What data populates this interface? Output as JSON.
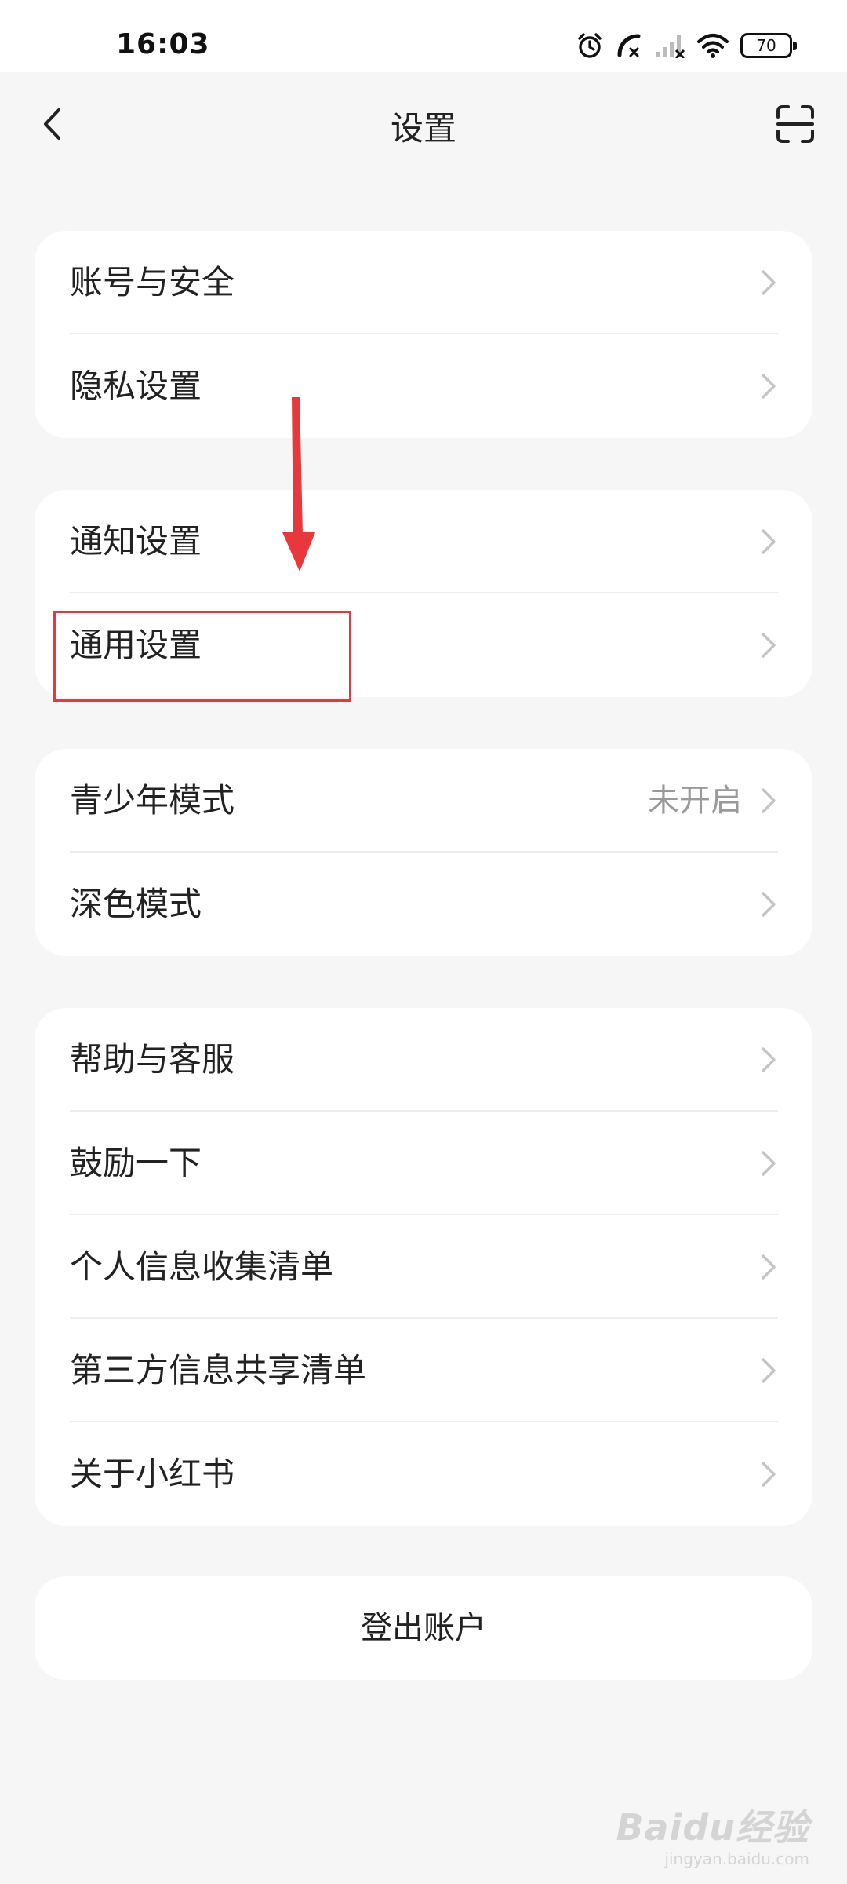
{
  "status_bar": {
    "time": "16:03",
    "battery": "70",
    "icons": [
      "alarm-icon",
      "missed-call-icon",
      "signal-icon",
      "wifi-icon",
      "battery-icon"
    ]
  },
  "header": {
    "title": "设置",
    "back_icon": "back-arrow-icon",
    "scan_icon": "scan-icon"
  },
  "groups": [
    {
      "items": [
        {
          "label": "账号与安全"
        },
        {
          "label": "隐私设置"
        }
      ]
    },
    {
      "items": [
        {
          "label": "通知设置"
        },
        {
          "label": "通用设置"
        }
      ]
    },
    {
      "items": [
        {
          "label": "青少年模式",
          "value": "未开启"
        },
        {
          "label": "深色模式"
        }
      ]
    },
    {
      "items": [
        {
          "label": "帮助与客服"
        },
        {
          "label": "鼓励一下"
        },
        {
          "label": "个人信息收集清单"
        },
        {
          "label": "第三方信息共享清单"
        },
        {
          "label": "关于小红书"
        }
      ]
    }
  ],
  "logout_label": "登出账户",
  "annotation": {
    "color": "#e8383b"
  },
  "watermark": {
    "main": "Baidu经验",
    "sub": "jingyan.baidu.com"
  }
}
